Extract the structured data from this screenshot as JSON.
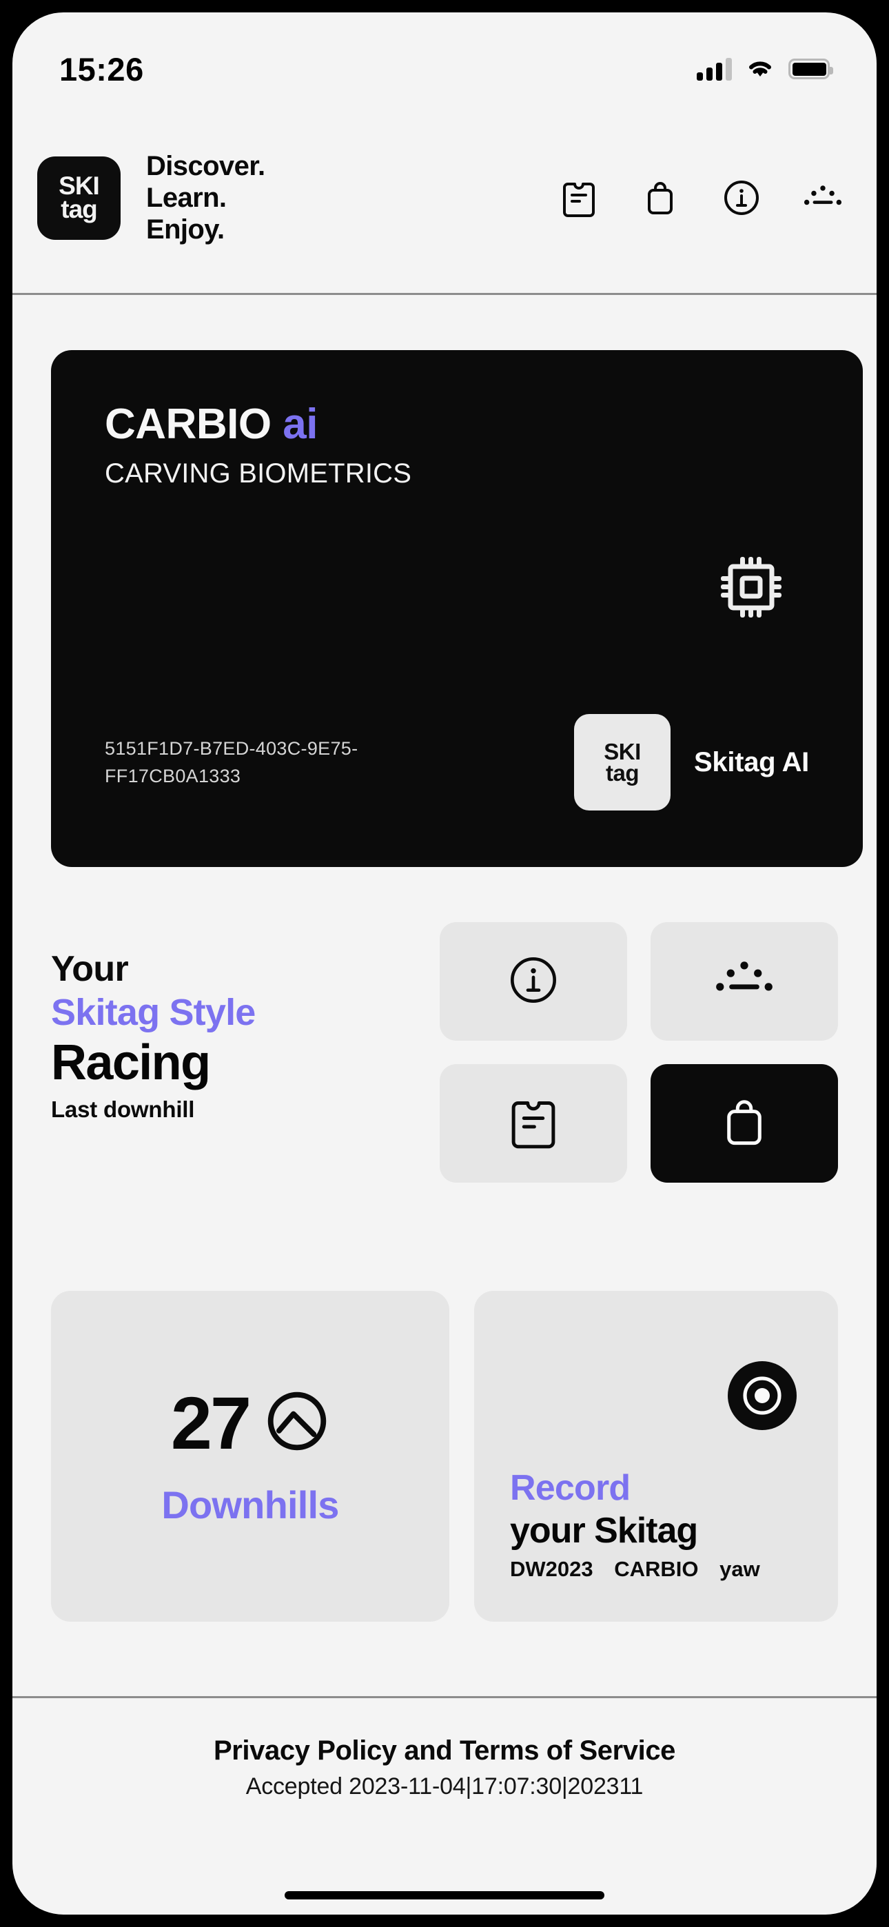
{
  "statusbar": {
    "time": "15:26",
    "cellular_icon": "cellular-bars-icon",
    "wifi_icon": "wifi-icon",
    "battery_icon": "battery-full-icon"
  },
  "header": {
    "logo": {
      "line1": "SKI",
      "line2": "tag"
    },
    "tagline_lines": [
      "Discover.",
      "Learn.",
      "Enjoy."
    ],
    "icons": [
      {
        "name": "clipboard-icon",
        "label": "clipboard"
      },
      {
        "name": "bag-icon",
        "label": "bag"
      },
      {
        "name": "info-circle-icon",
        "label": "info"
      },
      {
        "name": "slope-dots-icon",
        "label": "slope dots"
      }
    ]
  },
  "carbio_card": {
    "title_main": "CARBIO",
    "title_accent": "ai",
    "subtitle": "CARVING BIOMETRICS",
    "chip_icon": "cpu-chip-icon",
    "device_uuid": "5151F1D7-B7ED-403C-9E75-FF17CB0A1333",
    "badge_logo": {
      "line1": "SKI",
      "line2": "tag"
    },
    "badge_label": "Skitag AI"
  },
  "style_section": {
    "line1": "Your",
    "line2": "Skitag Style",
    "line3": "Racing",
    "line4": "Last downhill",
    "tiles": [
      {
        "name": "info-circle-tile",
        "icon": "info-circle-icon",
        "active": false
      },
      {
        "name": "slope-dots-tile",
        "icon": "slope-dots-icon",
        "active": false
      },
      {
        "name": "clipboard-tile",
        "icon": "clipboard-icon",
        "active": false
      },
      {
        "name": "bag-tile",
        "icon": "bag-icon",
        "active": true
      }
    ]
  },
  "downhills_card": {
    "count": "27",
    "icon": "mountain-circle-icon",
    "label": "Downhills"
  },
  "record_card": {
    "icon": "record-button-icon",
    "line1": "Record",
    "line2": "your Skitag",
    "tags": [
      "DW2023",
      "CARBIO",
      "yaw"
    ]
  },
  "footer": {
    "policy_text": "Privacy Policy and Terms of Service",
    "accepted_text": "Accepted 2023-11-04|17:07:30|202311"
  },
  "colors": {
    "background": "#f4f4f4",
    "accent_purple": "#7c72f0",
    "dark": "#0b0b0b",
    "tile_gray": "#e6e6e6"
  }
}
